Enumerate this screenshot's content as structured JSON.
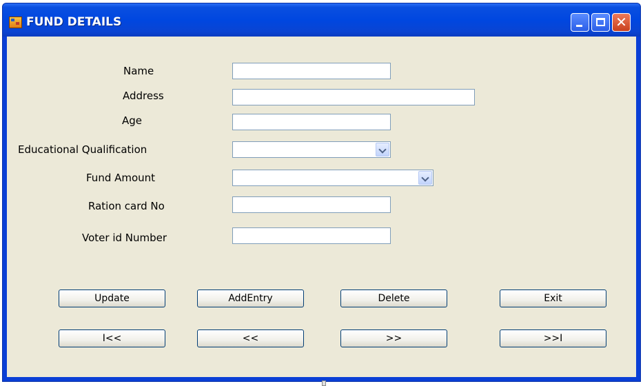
{
  "window": {
    "title": "FUND DETAILS",
    "controls": {
      "minimize": "minimize",
      "maximize": "maximize",
      "close": "✕"
    }
  },
  "form": {
    "name_label": "Name",
    "name_value": "",
    "address_label": "Address",
    "address_value": "",
    "age_label": "Age",
    "age_value": "",
    "education_label": "Educational Qualification",
    "education_value": "",
    "fund_label": "Fund Amount",
    "fund_value": "",
    "ration_label": "Ration card No",
    "ration_value": "",
    "voter_label": "Voter id Number",
    "voter_value": ""
  },
  "buttons": {
    "update": "Update",
    "add_entry": "AddEntry",
    "delete": "Delete",
    "exit": "Exit",
    "first": "I<<",
    "prev": "<<",
    "next": ">>",
    "last": ">>I"
  },
  "colors": {
    "titlebar": "#0047e0",
    "client_bg": "#ece9d8",
    "field_border": "#7f9db9"
  }
}
